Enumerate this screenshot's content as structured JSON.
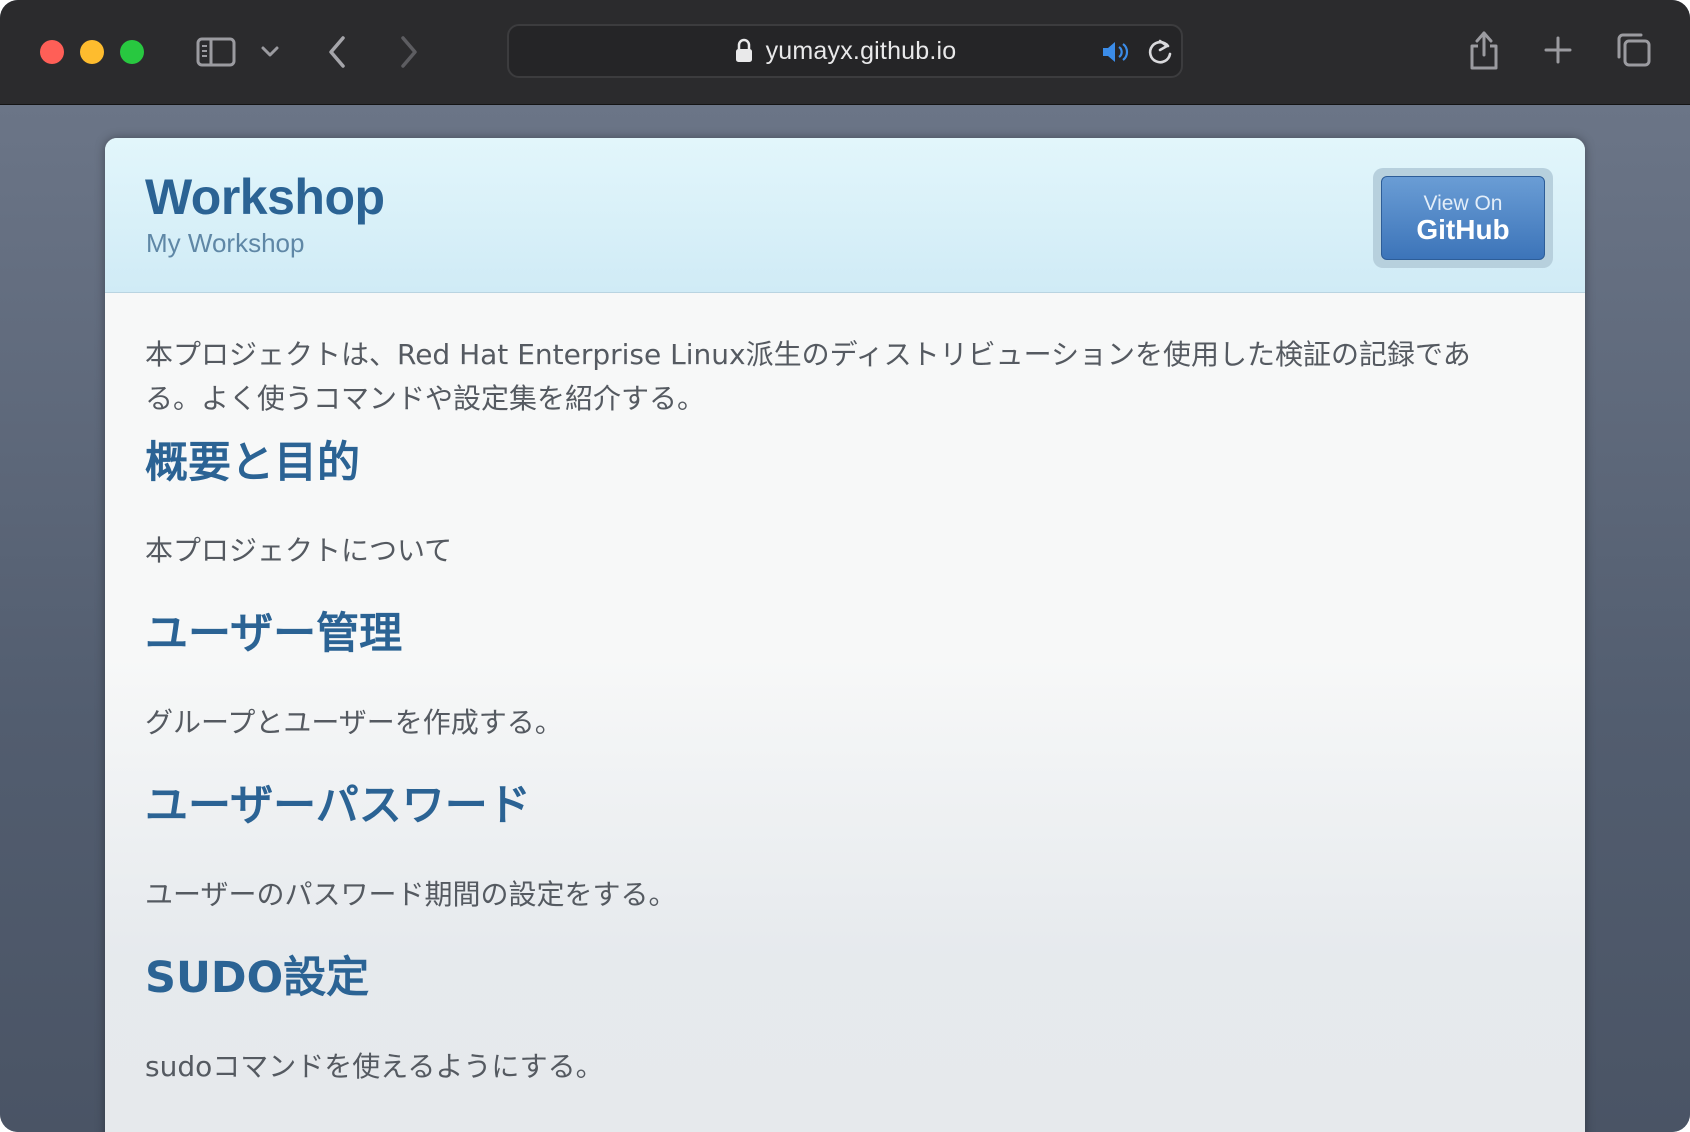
{
  "browser": {
    "url": "yumayx.github.io"
  },
  "header": {
    "title": "Workshop",
    "subtitle": "My Workshop",
    "github_button": {
      "small": "View On",
      "big": "GitHub"
    }
  },
  "main": {
    "intro": "本プロジェクトは、Red Hat Enterprise Linux派生のディストリビューションを使用した検証の記録である。よく使うコマンドや設定集を紹介する。",
    "sections": [
      {
        "heading": "概要と目的",
        "text": "本プロジェクトについて"
      },
      {
        "heading": "ユーザー管理",
        "text": "グループとユーザーを作成する。"
      },
      {
        "heading": "ユーザーパスワード",
        "text": "ユーザーのパスワード期間の設定をする。"
      },
      {
        "heading": "SUDO設定",
        "text": "sudoコマンドを使えるようにする。"
      }
    ]
  }
}
